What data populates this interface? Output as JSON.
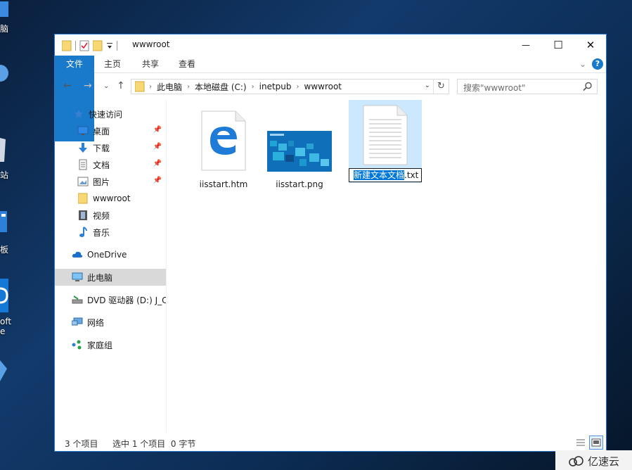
{
  "desktop": {
    "labels": [
      "脑",
      "站",
      "板",
      "oft",
      "e"
    ]
  },
  "window": {
    "title": "wwwroot",
    "minimize": "—",
    "maximize": "☐",
    "close": "✕"
  },
  "ribbon": {
    "tabs": [
      "文件",
      "主页",
      "共享",
      "查看"
    ],
    "expand": "⌄",
    "help": "?"
  },
  "address": {
    "crumbs": [
      "此电脑",
      "本地磁盘 (C:)",
      "inetpub",
      "wwwroot"
    ],
    "refresh": "↻",
    "dropdown": "⌄"
  },
  "search": {
    "placeholder": "搜索\"wwwroot\""
  },
  "sidebar": {
    "quick_access": "快速访问",
    "items": [
      {
        "label": "桌面",
        "pinned": true
      },
      {
        "label": "下载",
        "pinned": true
      },
      {
        "label": "文档",
        "pinned": true
      },
      {
        "label": "图片",
        "pinned": true
      },
      {
        "label": "wwwroot",
        "pinned": false
      },
      {
        "label": "视频",
        "pinned": false
      },
      {
        "label": "音乐",
        "pinned": false
      }
    ],
    "onedrive": "OneDrive",
    "this_pc": "此电脑",
    "dvd": "DVD 驱动器 (D:) J_C",
    "network": "网络",
    "homegroup": "家庭组"
  },
  "files": [
    {
      "name": "iisstart.htm",
      "type": "edge-html"
    },
    {
      "name": "iisstart.png",
      "type": "image"
    },
    {
      "name_selected": "新建文本文档",
      "name_ext": ".txt",
      "type": "text",
      "renaming": true
    }
  ],
  "status": {
    "count": "3 个项目",
    "selection": "选中 1 个项目  0 字节"
  },
  "watermark": {
    "text": "亿速云"
  },
  "colors": {
    "accent": "#1979ca",
    "selection": "#cce8ff",
    "highlight": "#0078d7",
    "folder": "#f8d775"
  }
}
